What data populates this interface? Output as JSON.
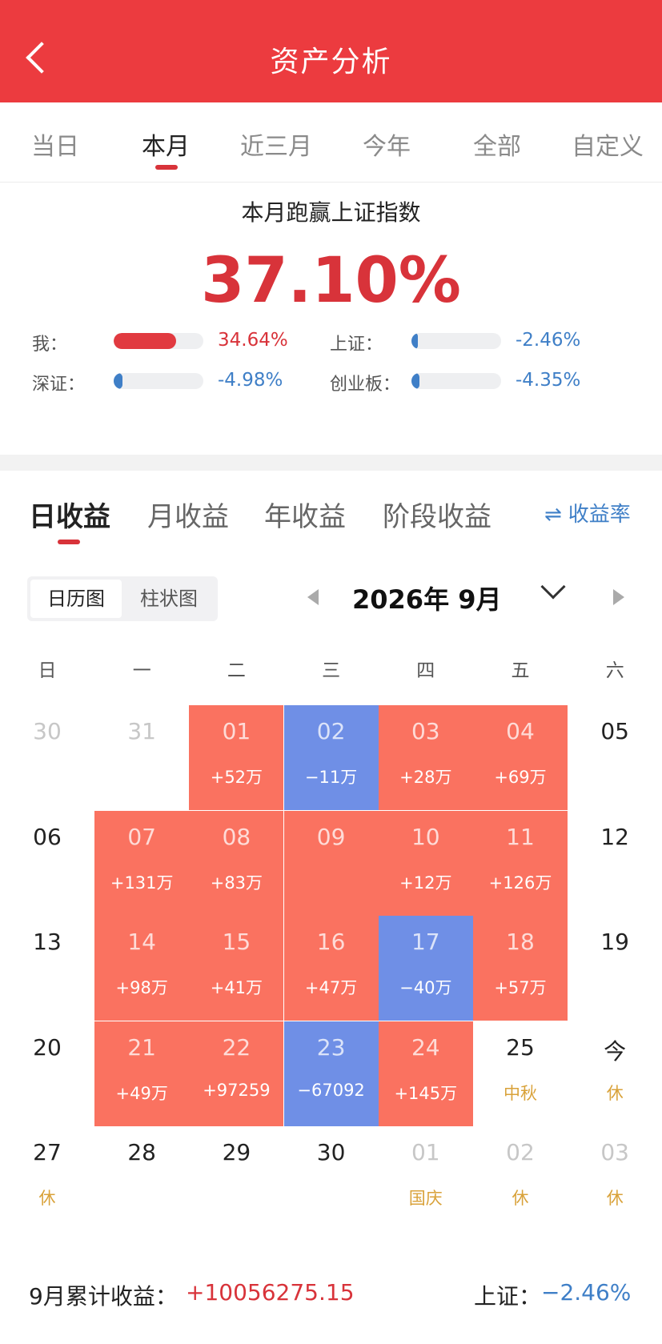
{
  "header": {
    "title": "资产分析"
  },
  "period_tabs": [
    "当日",
    "本月",
    "近三月",
    "今年",
    "全部",
    "自定义"
  ],
  "summary": {
    "title": "本月跑赢上证指数",
    "value": "37.10%"
  },
  "comparisons": [
    {
      "label": "我：",
      "value": "34.64%",
      "fill": 0.7,
      "color": "#e13a40",
      "value_color": "#d8333a"
    },
    {
      "label": "上证：",
      "value": "-2.46%",
      "fill": 0.05,
      "color": "#3f7fc7",
      "value_color": "#3f7fc7"
    },
    {
      "label": "深证：",
      "value": "-4.98%",
      "fill": 0.1,
      "color": "#3f7fc7",
      "value_color": "#3f7fc7"
    },
    {
      "label": "创业板：",
      "value": "-4.35%",
      "fill": 0.09,
      "color": "#3f7fc7",
      "value_color": "#3f7fc7"
    }
  ],
  "return_tabs": [
    "日收益",
    "月收益",
    "年收益",
    "阶段收益"
  ],
  "rate_toggle": "收益率",
  "view_switch": [
    "日历图",
    "柱状图"
  ],
  "month": "2026年 9月",
  "weekdays": [
    "日",
    "一",
    "二",
    "三",
    "四",
    "五",
    "六"
  ],
  "calendar": [
    [
      {
        "day": "30",
        "muted": true
      },
      {
        "day": "31",
        "muted": true
      },
      {
        "day": "01",
        "pnl": "+52万",
        "state": "gain"
      },
      {
        "day": "02",
        "pnl": "−11万",
        "state": "loss"
      },
      {
        "day": "03",
        "pnl": "+28万",
        "state": "gain"
      },
      {
        "day": "04",
        "pnl": "+69万",
        "state": "gain"
      },
      {
        "day": "05"
      }
    ],
    [
      {
        "day": "06"
      },
      {
        "day": "07",
        "pnl": "+131万",
        "state": "gain"
      },
      {
        "day": "08",
        "pnl": "+83万",
        "state": "gain"
      },
      {
        "day": "09",
        "pnl": "",
        "state": "gain"
      },
      {
        "day": "10",
        "pnl": "+12万",
        "state": "gain"
      },
      {
        "day": "11",
        "pnl": "+126万",
        "state": "gain"
      },
      {
        "day": "12"
      }
    ],
    [
      {
        "day": "13"
      },
      {
        "day": "14",
        "pnl": "+98万",
        "state": "gain"
      },
      {
        "day": "15",
        "pnl": "+41万",
        "state": "gain"
      },
      {
        "day": "16",
        "pnl": "+47万",
        "state": "gain"
      },
      {
        "day": "17",
        "pnl": "−40万",
        "state": "loss"
      },
      {
        "day": "18",
        "pnl": "+57万",
        "state": "gain"
      },
      {
        "day": "19"
      }
    ],
    [
      {
        "day": "20"
      },
      {
        "day": "21",
        "pnl": "+49万",
        "state": "gain"
      },
      {
        "day": "22",
        "pnl": "+97259",
        "state": "gain"
      },
      {
        "day": "23",
        "pnl": "−67092",
        "state": "loss"
      },
      {
        "day": "24",
        "pnl": "+145万",
        "state": "gain"
      },
      {
        "day": "25",
        "note": "中秋"
      },
      {
        "day": "今",
        "note": "休"
      }
    ],
    [
      {
        "day": "27",
        "note": "休"
      },
      {
        "day": "28"
      },
      {
        "day": "29"
      },
      {
        "day": "30"
      },
      {
        "day": "01",
        "muted": true,
        "note": "国庆"
      },
      {
        "day": "02",
        "muted": true,
        "note": "休"
      },
      {
        "day": "03",
        "muted": true,
        "note": "休"
      }
    ]
  ],
  "footer": {
    "label": "9月累计收益：",
    "total": "+10056275.15",
    "sh_label": "上证：",
    "sh_value": "−2.46%"
  }
}
